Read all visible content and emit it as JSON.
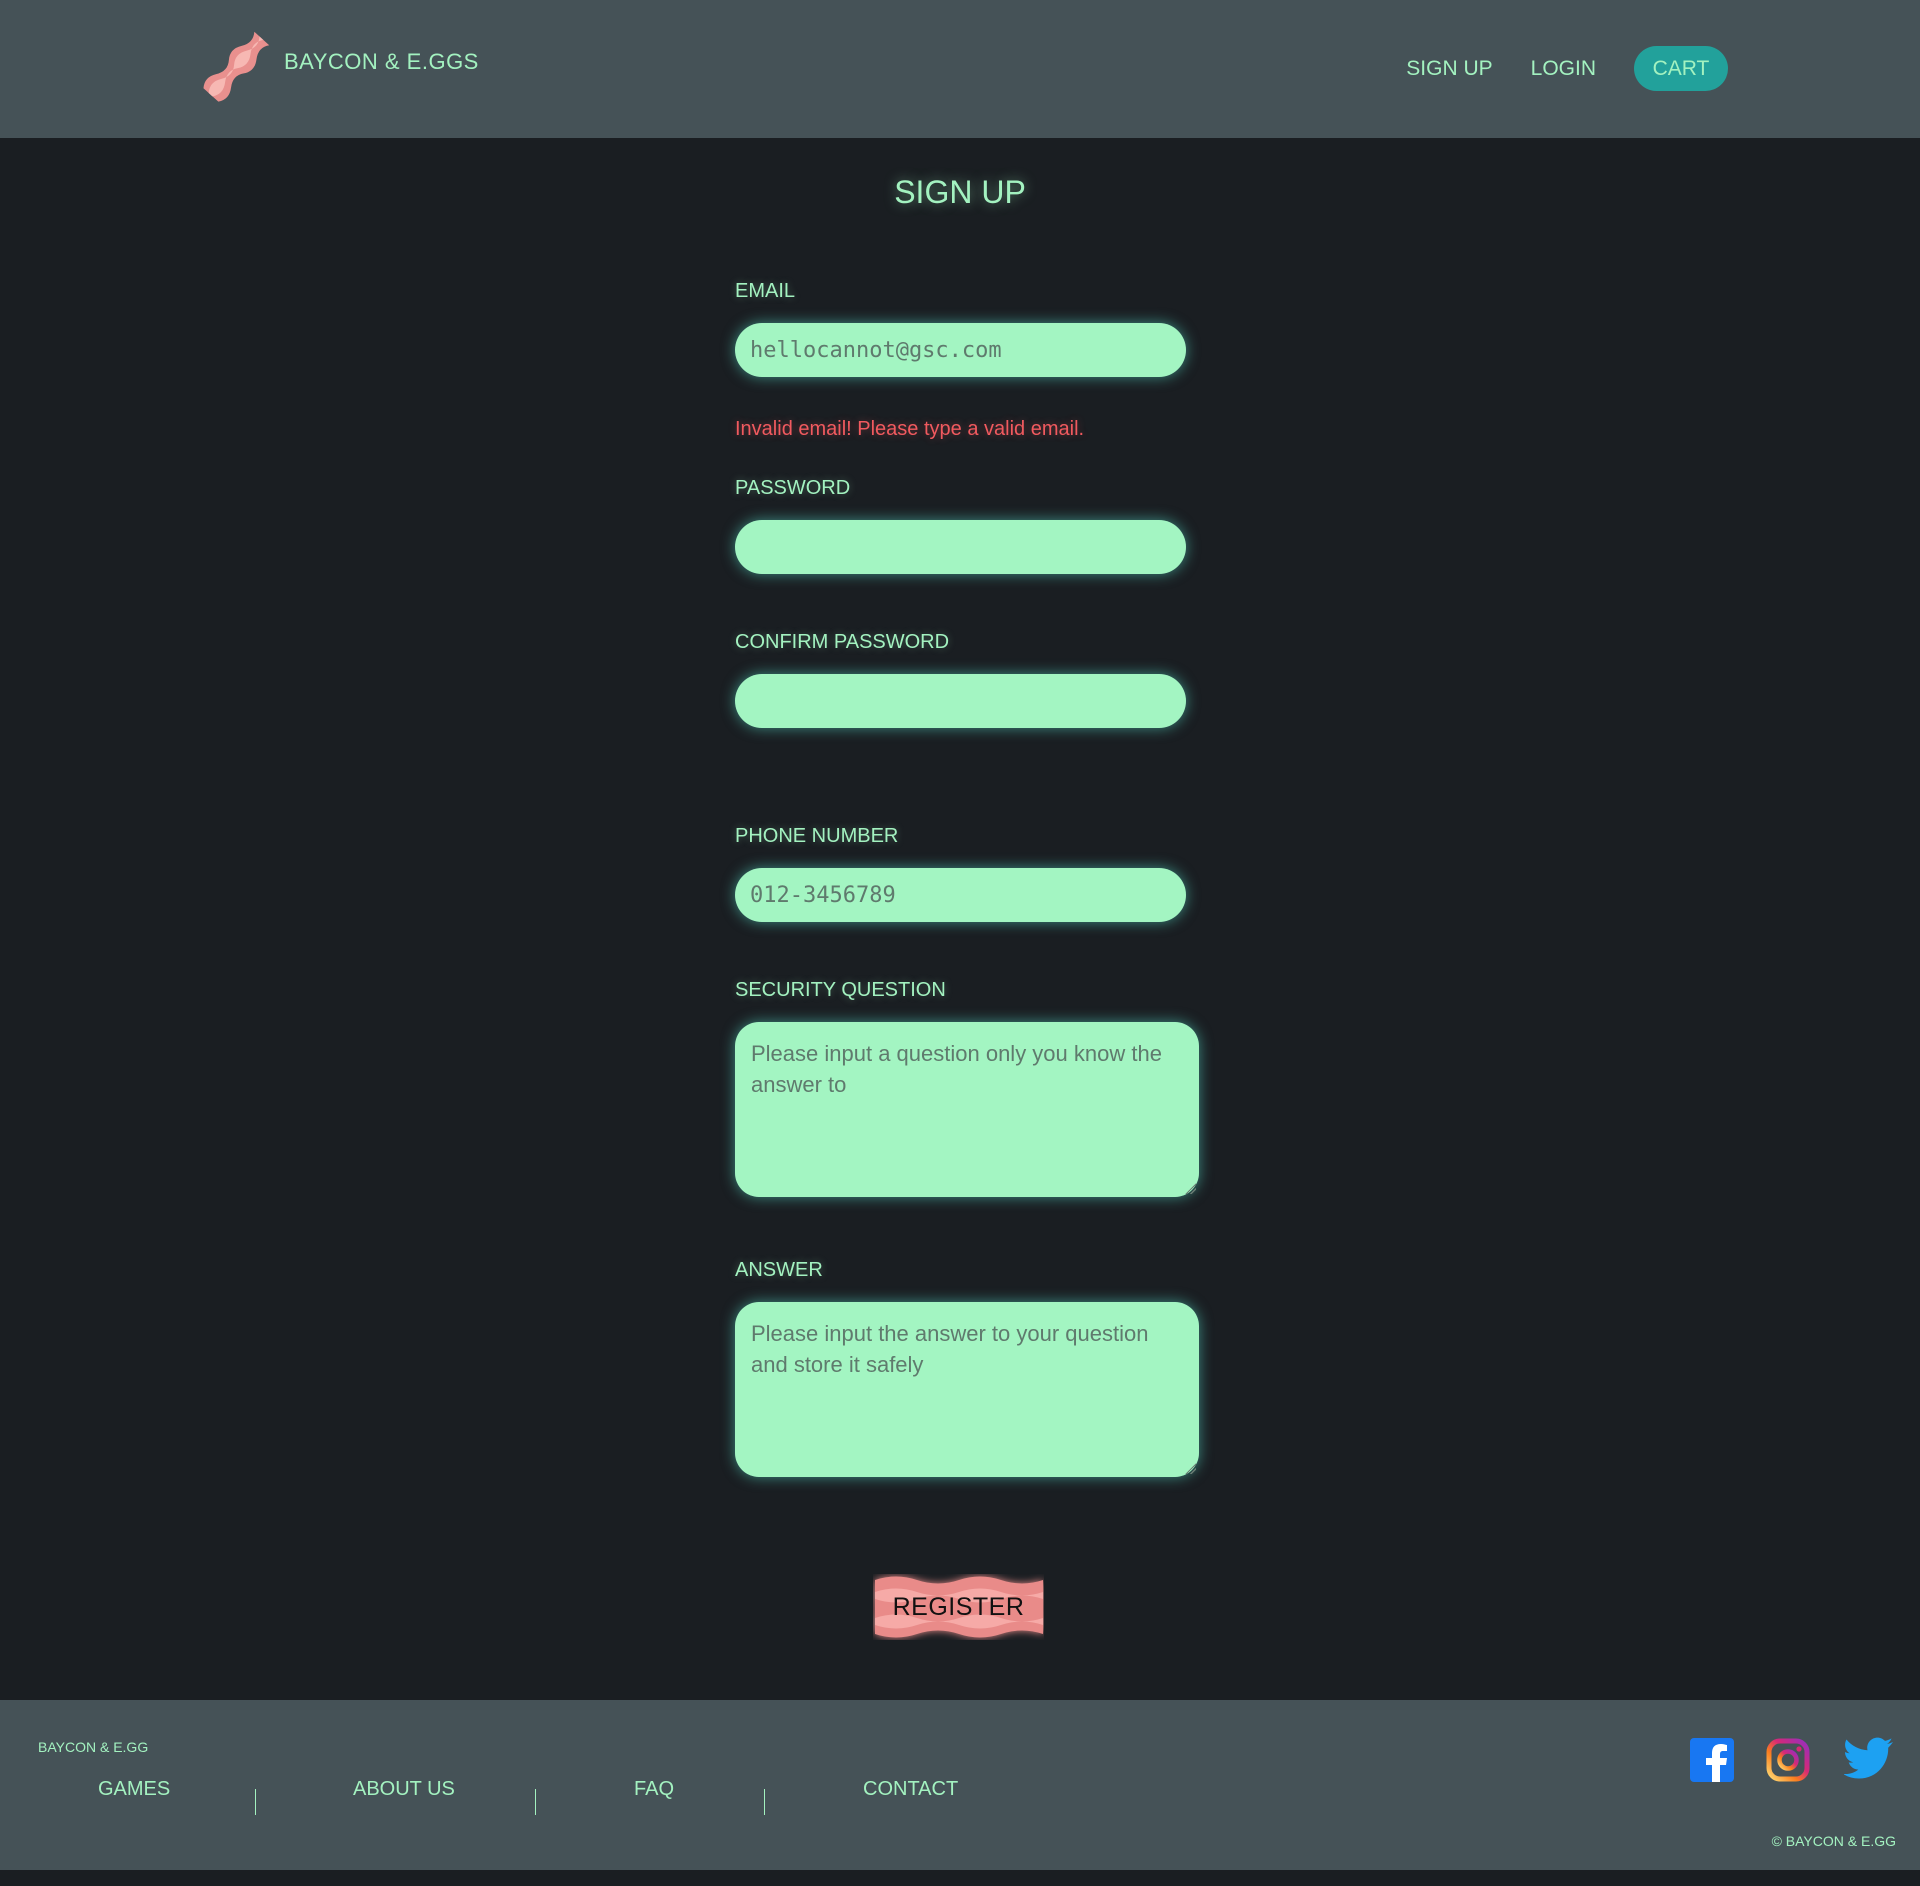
{
  "header": {
    "brand_name": "BAYCON & E.GGS",
    "nav": {
      "signup": "SIGN UP",
      "login": "LOGIN",
      "cart": "CART"
    }
  },
  "form": {
    "title": "SIGN UP",
    "email": {
      "label": "EMAIL",
      "value": "hellocannot@gsc.com"
    },
    "email_error": "Invalid email! Please type a valid email.",
    "password": {
      "label": "PASSWORD",
      "value": ""
    },
    "confirm_password": {
      "label": "CONFIRM PASSWORD",
      "value": ""
    },
    "phone": {
      "label": "PHONE NUMBER",
      "placeholder": "012-3456789"
    },
    "security_question": {
      "label": "SECURITY QUESTION",
      "placeholder": "Please input a question only you know the answer to"
    },
    "answer": {
      "label": "ANSWER",
      "placeholder": "Please input the answer to your question and store it safely"
    },
    "register_label": "REGISTER"
  },
  "footer": {
    "brand": "BAYCON & E.GG",
    "links": [
      "GAMES",
      "ABOUT US",
      "FAQ",
      "CONTACT"
    ],
    "social_icons": [
      "facebook-icon",
      "instagram-icon",
      "twitter-icon"
    ],
    "copyright": "© BAYCON & E.GG"
  },
  "colors": {
    "accent_text": "#a3f2c0",
    "input_bg": "#a3f5c2",
    "header_bg": "#455257",
    "page_bg": "#1a1e22",
    "cart_bg": "#22a19b",
    "error": "#f15a5f",
    "bacon": "#e88b8b"
  }
}
